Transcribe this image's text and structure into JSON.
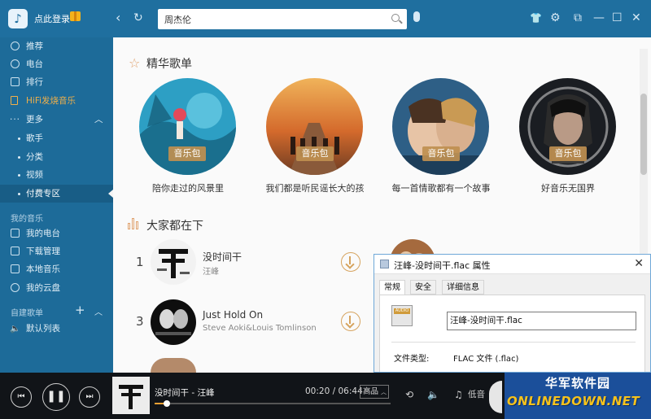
{
  "header": {
    "login_label": "点此登录",
    "search_value": "周杰伦"
  },
  "sidebar": {
    "items": [
      {
        "label": "推荐"
      },
      {
        "label": "电台"
      },
      {
        "label": "排行"
      },
      {
        "label": "HiFi发烧音乐"
      },
      {
        "label": "更多"
      },
      {
        "label": "歌手"
      },
      {
        "label": "分类"
      },
      {
        "label": "视频"
      },
      {
        "label": "付费专区"
      }
    ],
    "my_music_label": "我的音乐",
    "my_items": [
      {
        "label": "我的电台"
      },
      {
        "label": "下载管理"
      },
      {
        "label": "本地音乐"
      },
      {
        "label": "我的云盘"
      }
    ],
    "custom_label": "自建歌单",
    "default_list": "默认列表"
  },
  "featured": {
    "title": "精华歌单",
    "badge": "音乐包",
    "playlists": [
      {
        "caption": "陪你走过的风景里"
      },
      {
        "caption": "我们都是听民谣长大的孩"
      },
      {
        "caption": "每一首情歌都有一个故事"
      },
      {
        "caption": "好音乐无国界"
      }
    ]
  },
  "trending": {
    "title": "大家都在下",
    "rows": [
      {
        "rank": "1",
        "song": "没时间干",
        "artist": "汪峰"
      },
      {
        "rank": "3",
        "song": "Just Hold On",
        "artist": "Steve Aoki&Louis Tomlinson"
      }
    ]
  },
  "dialog": {
    "title": "汪峰-没时间干.flac 属性",
    "tabs": [
      "常规",
      "安全",
      "详细信息"
    ],
    "filename": "汪峰-没时间干.flac",
    "file_type_label": "文件类型:",
    "file_type_value": "FLAC 文件 (.flac)",
    "icon_label": "AUDIO"
  },
  "player": {
    "now_playing": "没时间干 - 汪峰",
    "elapsed": "00:20",
    "duration": "06:44",
    "quality": "高品",
    "volume_label": "低音",
    "progress": 0.05
  },
  "watermark": {
    "cn": "华军软件园",
    "en": "ONLINEDOWN.NET"
  }
}
